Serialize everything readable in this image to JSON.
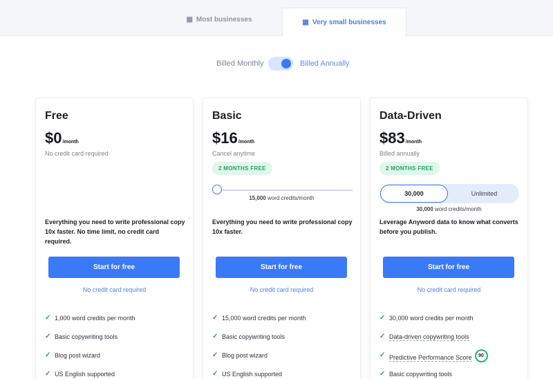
{
  "tabs": [
    {
      "label": "Most businesses",
      "icon": "building-icon"
    },
    {
      "label": "Very small businesses",
      "icon": "office-icon"
    }
  ],
  "billing": {
    "monthly_label": "Billed Monthly",
    "annual_label": "Billed Annually",
    "annual_selected": true
  },
  "colors": {
    "accent": "#3b7af6",
    "success": "#22a06b",
    "badge_bg": "#e0f7ea"
  },
  "plans": [
    {
      "name": "Free",
      "price": "$0",
      "period": "/month",
      "subtitle": "No credit card required",
      "description": "Everything you need to write professional copy 10x faster. No time limit, no credit card required.",
      "cta": "Start for free",
      "cta_note": "No credit card required",
      "features": [
        "1,000 word credits per month",
        "Basic copywriting tools",
        "Blog post wizard",
        "US English supported"
      ]
    },
    {
      "name": "Basic",
      "price": "$16",
      "period": "/month",
      "subtitle": "Cancel anytime",
      "badge": "2 MONTHS FREE",
      "slider_value": "15,000",
      "slider_suffix": " word credits/month",
      "description": "Everything you need to write professional copy 10x faster.",
      "cta": "Start for free",
      "cta_note": "No credit card required",
      "features": [
        "15,000 word credits per month",
        "Basic copywriting tools",
        "Blog post wizard",
        "US English supported"
      ]
    },
    {
      "name": "Data-Driven",
      "price": "$83",
      "period": "/month",
      "subtitle": "Billed annually",
      "badge": "2 MONTHS FREE",
      "segment_options": [
        "30,000",
        "Unlimited"
      ],
      "segment_selected": "30,000",
      "credits_value": "30,000",
      "credits_suffix": " word credits/month",
      "description": "Leverage Anyword data to know what converts before you publish.",
      "cta": "Start for free",
      "cta_note": "No credit card required",
      "features": [
        "30,000 word credits per month",
        "Data-driven copywriting tools",
        "Predictive Performance Score",
        "Basic copywriting tools"
      ],
      "score_badge": "90"
    }
  ]
}
